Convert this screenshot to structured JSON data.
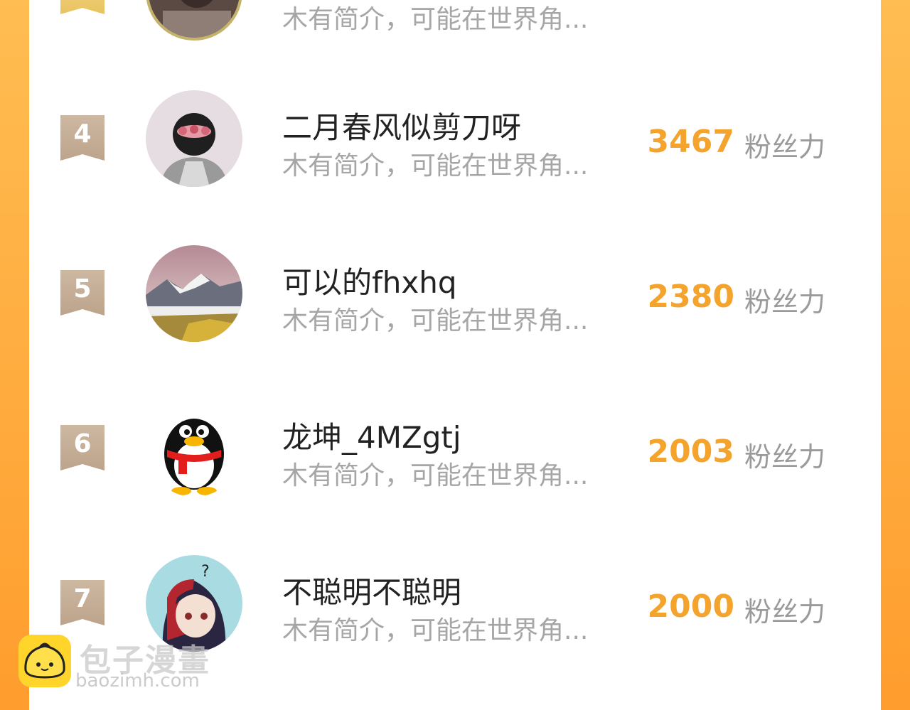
{
  "ranking": {
    "score_unit": "粉丝力",
    "partial_top": {
      "bio": "木有简介，可能在世界角..."
    },
    "items": [
      {
        "rank": "4",
        "name": "二月春风似剪刀呀",
        "bio": "木有简介，可能在世界角...",
        "score": "3467",
        "avatar": "masked-figure-avatar"
      },
      {
        "rank": "5",
        "name": "可以的fhxhq",
        "bio": "木有简介，可能在世界角...",
        "score": "2380",
        "avatar": "mountain-landscape-avatar"
      },
      {
        "rank": "6",
        "name": "龙坤_4MZgtj",
        "bio": "木有简介，可能在世界角...",
        "score": "2003",
        "avatar": "qq-penguin-avatar"
      },
      {
        "rank": "7",
        "name": "不聪明不聪明",
        "bio": "木有简介，可能在世界角...",
        "score": "2000",
        "avatar": "anime-girl-avatar"
      }
    ]
  },
  "watermark": {
    "title": "包子漫畫",
    "url": "baozimh.com"
  },
  "colors": {
    "accent": "#f4a32c",
    "background_orange": "#ff9d2e",
    "badge": "#bda38b"
  }
}
